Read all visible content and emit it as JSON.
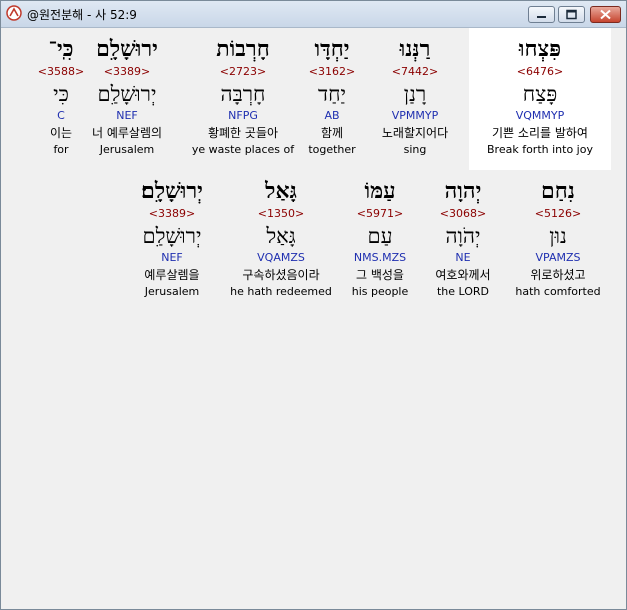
{
  "window": {
    "title": "@원전분해 - 사 52:9"
  },
  "rows": [
    [
      {
        "hebrew": "כִּֽי־",
        "strong": "<3588>",
        "lemma": "כִּי",
        "morph": "C",
        "korean": "이는",
        "english": "for"
      },
      {
        "hebrew": "ירוּשָׁלִָם",
        "strong": "<3389>",
        "lemma": "יְרוּשָׁלַ͏ִם",
        "morph": "NEF",
        "korean": "너 예루살렘의",
        "english": "Jerusalem"
      },
      {
        "hebrew": "חָרְבוֹת",
        "strong": "<2723>",
        "lemma": "חָרְבָּה",
        "morph": "NFPG",
        "korean": "황폐한 곳들아",
        "english": "ye waste places of"
      },
      {
        "hebrew": "יַחְדָּו",
        "strong": "<3162>",
        "lemma": "יַחַד",
        "morph": "AB",
        "korean": "함께",
        "english": "together"
      },
      {
        "hebrew": "רַנְּנוּ",
        "strong": "<7442>",
        "lemma": "רָנַן",
        "morph": "VPMMYP",
        "korean": "노래할지어다",
        "english": "sing"
      },
      {
        "hebrew": "פִּצְחוּ",
        "strong": "<6476>",
        "lemma": "פָּצַח",
        "morph": "VQMMYP",
        "korean": "기쁜 소리를 발하여",
        "english": "Break forth into joy"
      }
    ],
    [
      {
        "hebrew": "יְרוּשָׁלִָם׃",
        "strong": "<3389>",
        "lemma": "יְרוּשָׁלַ͏ִם",
        "morph": "NEF",
        "korean": "예루살렘을",
        "english": "Jerusalem"
      },
      {
        "hebrew": "גָּאַל",
        "strong": "<1350>",
        "lemma": "גָּאַל",
        "morph": "VQAMZS",
        "korean": "구속하셨음이라",
        "english": "he hath redeemed"
      },
      {
        "hebrew": "עַמּוֹ",
        "strong": "<5971>",
        "lemma": "עַם",
        "morph": "NMS.MZS",
        "korean": "그 백성을",
        "english": "his people"
      },
      {
        "hebrew": "יְהוָה",
        "strong": "<3068>",
        "lemma": "יְהֹוָה",
        "morph": "NE",
        "korean": "여호와께서",
        "english": "the LORD"
      },
      {
        "hebrew": "נִחַם",
        "strong": "<5126>",
        "lemma": "נוּן",
        "morph": "VPAMZS",
        "korean": "위로하셨고",
        "english": "hath comforted"
      }
    ]
  ],
  "colors": {
    "strong": "#8b0000",
    "morph": "#1f2fb0",
    "highlight": "#ffffff"
  }
}
